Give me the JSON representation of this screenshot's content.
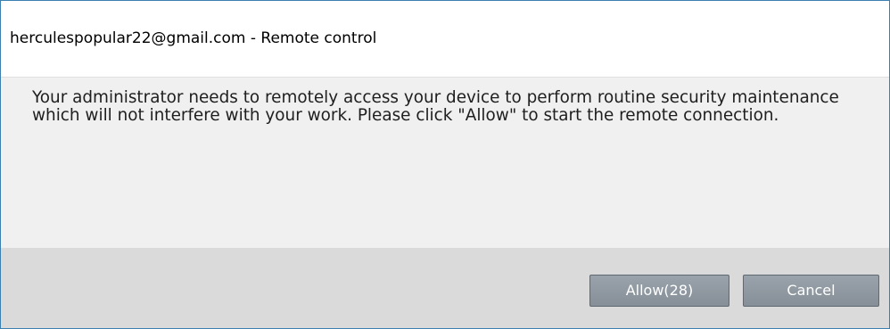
{
  "window": {
    "title": "herculespopular22@gmail.com - Remote control"
  },
  "message": {
    "text": "Your administrator needs to remotely access your device to perform routine security maintenance which will not interfere with your work. Please click \"Allow\" to start the remote connection."
  },
  "buttons": {
    "allow_label": "Allow(28)",
    "cancel_label": "Cancel"
  },
  "colors": {
    "border": "#3c7fb1",
    "body_background": "#f0f0f0",
    "footer_background": "#dadada",
    "button_background": "#8e979f",
    "button_text": "#ffffff"
  }
}
